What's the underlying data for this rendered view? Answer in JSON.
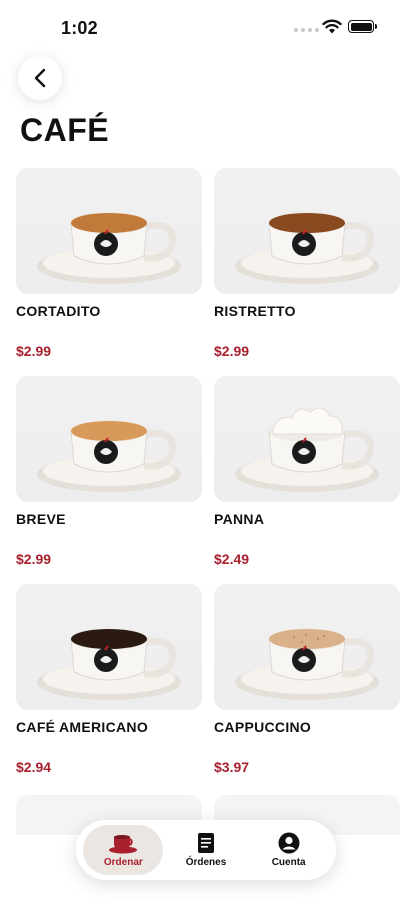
{
  "status_bar": {
    "time": "1:02"
  },
  "header": {
    "title": "CAFÉ"
  },
  "products": [
    {
      "name": "CORTADITO",
      "price": "$2.99",
      "drink": "cortadito"
    },
    {
      "name": "RISTRETTO",
      "price": "$2.99",
      "drink": "ristretto"
    },
    {
      "name": "BREVE",
      "price": "$2.99",
      "drink": "breve"
    },
    {
      "name": "PANNA",
      "price": "$2.49",
      "drink": "panna"
    },
    {
      "name": "CAFÉ AMERICANO",
      "price": "$2.94",
      "drink": "americano"
    },
    {
      "name": "CAPPUCCINO",
      "price": "$3.97",
      "drink": "cappuccino"
    }
  ],
  "tab_bar": {
    "items": [
      {
        "label": "Ordenar",
        "icon": "coffee-cup-icon",
        "active": true
      },
      {
        "label": "Órdenes",
        "icon": "receipt-icon",
        "active": false
      },
      {
        "label": "Cuenta",
        "icon": "account-icon",
        "active": false
      }
    ]
  },
  "colors": {
    "accent": "#a8202e",
    "card_bg": "#f0efef",
    "active_tab_bg": "#ece6e2"
  }
}
